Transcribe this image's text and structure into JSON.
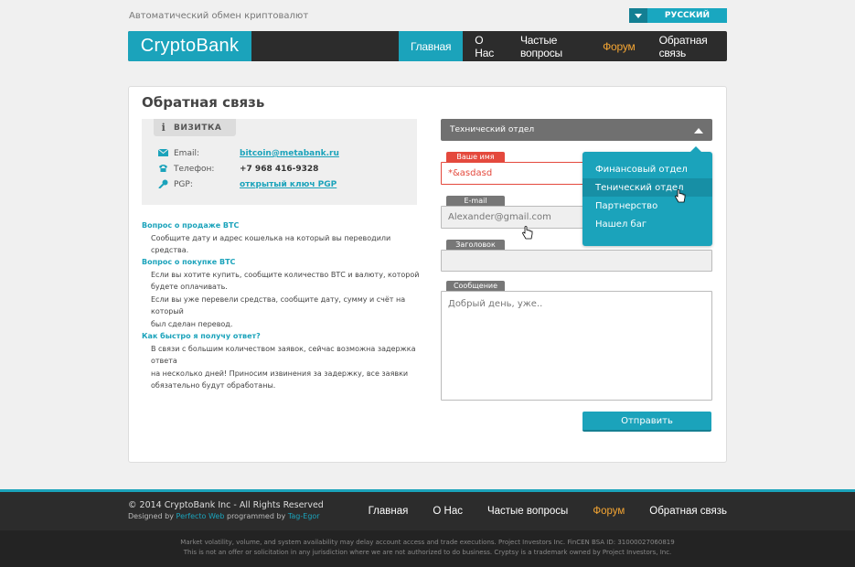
{
  "top": {
    "tagline": "Автоматический обмен криптовалют",
    "language": "РУССКИЙ"
  },
  "header": {
    "logo": "CryptoBank",
    "nav": [
      "Главная",
      "О Нас",
      "Частые вопросы",
      "Форум",
      "Обратная связь"
    ]
  },
  "page": {
    "title": "Обратная связь"
  },
  "vcard": {
    "tab": "ВИЗИТКА",
    "rows": [
      {
        "key": "Email:",
        "value": "bitcoin@metabank.ru"
      },
      {
        "key": "Телефон:",
        "value": "+7 968 416-9328"
      },
      {
        "key": "PGP:",
        "value": "открытый ключ PGP"
      }
    ]
  },
  "faq": [
    {
      "q": "Вопрос о продаже ВТС",
      "a": [
        "Сообщите дату и адрес кошелька на который вы переводили средства."
      ]
    },
    {
      "q": "Вопрос о покупке ВТС",
      "a": [
        "Если вы хотите купить, сообщите количество ВТС и валюту, которой",
        "будете оплачивать.",
        "Если вы уже перевели средства, сообщите дату, сумму и счёт на который",
        "был сделан перевод."
      ]
    },
    {
      "q": "Как быстро я получу ответ?",
      "a": [
        "В связи с большим количеством заявок, сейчас возможна задержка ответа",
        "на несколько дней! Приносим извинения за задержку, все заявки",
        "обязательно будут обработаны."
      ]
    }
  ],
  "form": {
    "department": "Технический отдел",
    "dropdown": [
      "Финансовый отдел",
      "Тенический отдел",
      "Партнерство",
      "Нашел баг"
    ],
    "name_label": "Ваше имя",
    "name_value": "*&asdasd",
    "email_label": "E-mail",
    "email_value": "Alexander@gmail.com",
    "subject_label": "Заголовок",
    "subject_value": "",
    "message_label": "Сообщение",
    "message_placeholder": "Добрый день, уже..",
    "submit": "Отправить"
  },
  "footer": {
    "copyright": "© 2014 CryptoBank Inc - All Rights Reserved",
    "designed_by": "Designed by",
    "designer": "Perfecto Web",
    "programmed_by": "programmed by",
    "programmer": "Tag-Egor",
    "nav": [
      "Главная",
      "О Нас",
      "Частые вопросы",
      "Форум",
      "Обратная связь"
    ],
    "disclaimer1": "Market volatility, volume, and system availability may delay account access and trade executions. Project Investors Inc. FinCEN BSA ID: 31000027060819",
    "disclaimer2": "This is not an offer or solicitation in any jurisdiction where we are not authorized to do business. Cryptsy is a trademark owned by Project Investors, Inc."
  },
  "colors": {
    "accent": "#1ba3bb",
    "forum": "#f4a533",
    "error": "#e4493d",
    "dark": "#2c2c2c"
  },
  "icons": [
    "chevron-down-icon",
    "info-icon",
    "mail-icon",
    "phone-icon",
    "key-icon",
    "caret-up-icon",
    "hand-cursor-icon"
  ]
}
